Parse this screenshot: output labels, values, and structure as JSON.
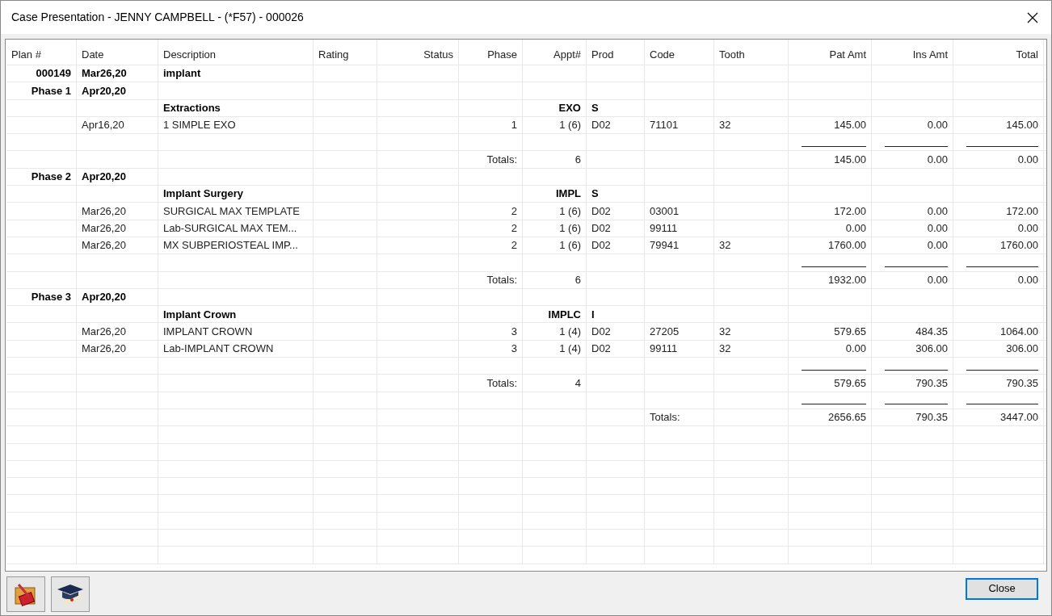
{
  "window": {
    "title": "Case Presentation - JENNY CAMPBELL - (*F57) - 000026"
  },
  "table": {
    "columns": [
      "Plan #",
      "Date",
      "Description",
      "Rating",
      "Status",
      "Phase",
      "Appt#",
      "Prod",
      "Code",
      "Tooth",
      "Pat Amt",
      "Ins Amt",
      "Total"
    ],
    "rows": [
      {
        "kind": "plan",
        "plan": "000149",
        "date": "Mar26,20",
        "description": "implant"
      },
      {
        "kind": "phase",
        "plan": "Phase 1",
        "date": "Apr20,20"
      },
      {
        "kind": "group",
        "description": "Extractions",
        "appt": "EXO",
        "prod": "S"
      },
      {
        "kind": "item",
        "date": "Apr16,20",
        "description": "1 SIMPLE EXO",
        "phase": "1",
        "appt": "1 (6)",
        "prod": "D02",
        "code": "71101",
        "tooth": "32",
        "pat_amt": "145.00",
        "ins_amt": "0.00",
        "total": "145.00"
      },
      {
        "kind": "rule"
      },
      {
        "kind": "subtotal",
        "phase": "Totals:",
        "appt": "6",
        "pat_amt": "145.00",
        "ins_amt": "0.00",
        "total": "0.00"
      },
      {
        "kind": "phase",
        "plan": "Phase 2",
        "date": "Apr20,20"
      },
      {
        "kind": "group",
        "description": "Implant Surgery",
        "appt": "IMPL",
        "prod": "S"
      },
      {
        "kind": "item",
        "date": "Mar26,20",
        "description": "SURGICAL MAX TEMPLATE",
        "phase": "2",
        "appt": "1 (6)",
        "prod": "D02",
        "code": "03001",
        "pat_amt": "172.00",
        "ins_amt": "0.00",
        "total": "172.00"
      },
      {
        "kind": "item",
        "date": "Mar26,20",
        "description": "Lab-SURGICAL MAX TEM...",
        "phase": "2",
        "appt": "1 (6)",
        "prod": "D02",
        "code": "99111",
        "pat_amt": "0.00",
        "ins_amt": "0.00",
        "total": "0.00"
      },
      {
        "kind": "item",
        "date": "Mar26,20",
        "description": "MX SUBPERIOSTEAL IMP...",
        "phase": "2",
        "appt": "1 (6)",
        "prod": "D02",
        "code": "79941",
        "tooth": "32",
        "pat_amt": "1760.00",
        "ins_amt": "0.00",
        "total": "1760.00"
      },
      {
        "kind": "rule"
      },
      {
        "kind": "subtotal",
        "phase": "Totals:",
        "appt": "6",
        "pat_amt": "1932.00",
        "ins_amt": "0.00",
        "total": "0.00"
      },
      {
        "kind": "phase",
        "plan": "Phase 3",
        "date": "Apr20,20"
      },
      {
        "kind": "group",
        "description": "Implant Crown",
        "appt": "IMPLC",
        "prod": "I"
      },
      {
        "kind": "item",
        "date": "Mar26,20",
        "description": "IMPLANT CROWN",
        "phase": "3",
        "appt": "1 (4)",
        "prod": "D02",
        "code": "27205",
        "tooth": "32",
        "pat_amt": "579.65",
        "ins_amt": "484.35",
        "total": "1064.00"
      },
      {
        "kind": "item",
        "date": "Mar26,20",
        "description": "Lab-IMPLANT CROWN",
        "phase": "3",
        "appt": "1 (4)",
        "prod": "D02",
        "code": "99111",
        "tooth": "32",
        "pat_amt": "0.00",
        "ins_amt": "306.00",
        "total": "306.00"
      },
      {
        "kind": "rule"
      },
      {
        "kind": "subtotal",
        "phase": "Totals:",
        "appt": "4",
        "pat_amt": "579.65",
        "ins_amt": "790.35",
        "total": "790.35"
      },
      {
        "kind": "rule"
      },
      {
        "kind": "grand_total",
        "code": "Totals:",
        "pat_amt": "2656.65",
        "ins_amt": "790.35",
        "total": "3447.00"
      }
    ]
  },
  "buttons": {
    "close": "Close"
  }
}
